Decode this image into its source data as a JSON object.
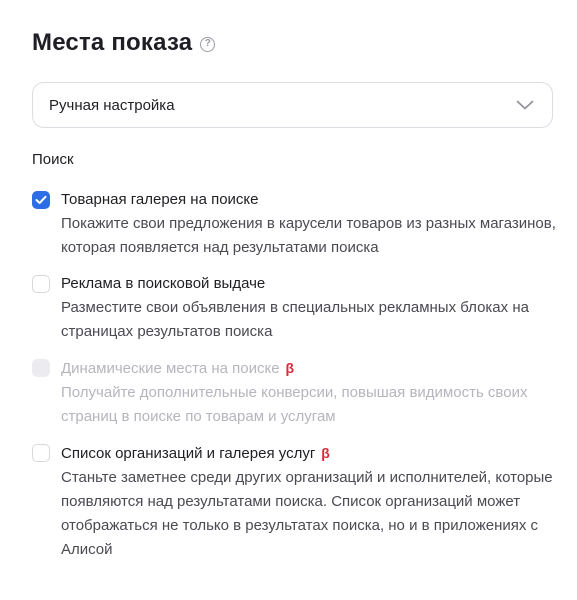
{
  "header": {
    "title": "Места показа",
    "help_icon": "question-circle-icon"
  },
  "select": {
    "value": "Ручная настройка",
    "icon": "chevron-down-icon"
  },
  "section": {
    "label": "Поиск"
  },
  "options": [
    {
      "title": "Товарная галерея на поиске",
      "description": "Покажите свои предложения в карусели товаров из разных магазинов, которая появляется над результатами поиска",
      "checked": true,
      "disabled": false,
      "beta": ""
    },
    {
      "title": "Реклама в поисковой выдаче",
      "description": "Разместите свои объявления в специальных рекламных блоках на страницах результатов поиска",
      "checked": false,
      "disabled": false,
      "beta": ""
    },
    {
      "title": "Динамические места на поиске",
      "description": "Получайте дополнительные конверсии, повышая видимость своих страниц в поиске по товарам и услугам",
      "checked": false,
      "disabled": true,
      "beta": "β"
    },
    {
      "title": "Список организаций и галерея услуг",
      "description": "Станьте заметнее среди других организаций и исполнителей, которые появляются над результатами поиска. Список организаций может отображаться не только в результатах поиска, но и в приложениях с Алисой",
      "checked": false,
      "disabled": false,
      "beta": "β"
    }
  ],
  "colors": {
    "accent": "#2d6ee6",
    "beta": "#e0263a",
    "disabled_text": "#b5b6bd"
  }
}
